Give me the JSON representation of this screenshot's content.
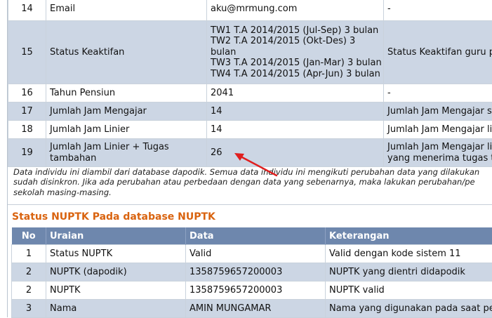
{
  "table1": {
    "rows": [
      {
        "no": "14",
        "label": "Email",
        "data": [
          "aku@mrmung.com"
        ],
        "ket": "-"
      },
      {
        "no": "15",
        "label": "Status Keaktifan",
        "data": [
          "TW1 T.A 2014/2015 (Jul-Sep) 3 bulan",
          "TW2 T.A 2014/2015 (Okt-Des) 3",
          "bulan",
          "TW3 T.A 2014/2015 (Jan-Mar) 3 bulan",
          "TW4 T.A 2014/2015 (Apr-Jun) 3 bulan"
        ],
        "ket": "Status Keaktifan guru pa"
      },
      {
        "no": "16",
        "label": "Tahun Pensiun",
        "data": [
          "2041"
        ],
        "ket": "-"
      },
      {
        "no": "17",
        "label": "Jumlah Jam Mengajar",
        "data": [
          "14"
        ],
        "ket": "Jumlah Jam Mengajar se"
      },
      {
        "no": "18",
        "label": "Jumlah Jam Linier",
        "data": [
          "14"
        ],
        "ket": "Jumlah Jam Mengajar lin"
      },
      {
        "no": "19",
        "label": [
          "Jumlah Jam Linier + Tugas",
          "tambahan"
        ],
        "data": [
          "26"
        ],
        "ket": [
          "Jumlah Jam Mengajar lin",
          "yang menerima tugas ta"
        ]
      }
    ]
  },
  "note": {
    "lines": [
      "Data individu ini diambil dari database dapodik. Semua data individu ini mengikuti perubahan data yang dilakukan",
      "sudah disinkron. Jika ada perubahan atau perbedaan dengan data yang sebenarnya, maka lakukan perubahan/pe",
      "sekolah masing-masing."
    ]
  },
  "nuptk": {
    "title": "Status NUPTK Pada database NUPTK",
    "headers": {
      "no": "No",
      "uraian": "Uraian",
      "data": "Data",
      "keterangan": "Keterangan"
    },
    "rows": [
      {
        "no": "1",
        "uraian": "Status NUPTK",
        "data": "Valid",
        "ket": "Valid dengan kode sistem 11"
      },
      {
        "no": "2",
        "uraian": "NUPTK (dapodik)",
        "data": "1358759657200003",
        "ket": "NUPTK yang dientri didapodik"
      },
      {
        "no": "2",
        "uraian": "NUPTK",
        "data": "1358759657200003",
        "ket": "NUPTK valid"
      },
      {
        "no": "3",
        "uraian": "Nama",
        "data": "AMIN MUNGAMAR",
        "ket": "Nama yang digunakan pada saat pen"
      }
    ]
  },
  "annotation": {
    "arrow_color": "#e01e1e",
    "arrow_icon": "red-arrow-icon"
  }
}
